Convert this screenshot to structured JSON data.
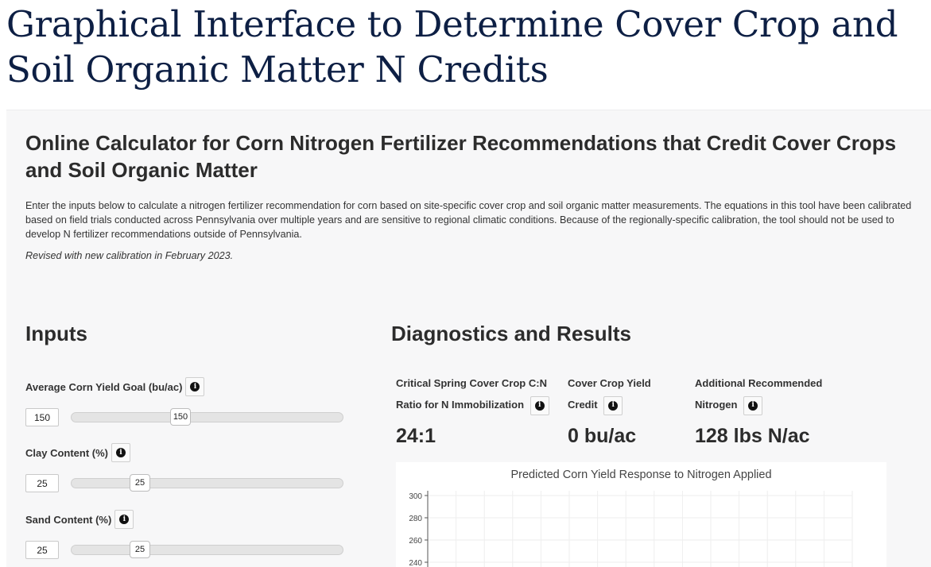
{
  "page": {
    "title": "Graphical Interface to Determine Cover Crop and Soil Organic Matter N Credits"
  },
  "calculator": {
    "title": "Online Calculator for Corn Nitrogen Fertilizer Recommendations that Credit Cover Crops and Soil Organic Matter",
    "intro": "Enter the inputs below to calculate a nitrogen fertilizer recommendation for corn based on site-specific cover crop and soil organic matter measurements. The equations in this tool have been calibrated based on field trials conducted across Pennsylvania over multiple years and are sensitive to regional climatic conditions. Because of the regionally-specific calibration, the tool should not be used to develop N fertilizer recommendations outside of Pennsylvania.",
    "revised": "Revised with new calibration in February 2023."
  },
  "inputs": {
    "heading": "Inputs",
    "fields": [
      {
        "label": "Average Corn Yield Goal (bu/ac)",
        "value": "150",
        "slider_position": 0.42,
        "icon": "info-icon"
      },
      {
        "label": "Clay Content (%)",
        "value": "25",
        "slider_position": 0.25,
        "icon": "info-icon"
      },
      {
        "label": "Sand Content (%)",
        "value": "25",
        "slider_position": 0.25,
        "icon": "info-icon"
      }
    ]
  },
  "results": {
    "heading": "Diagnostics and Results",
    "metrics": [
      {
        "label_line1": "Critical Spring Cover Crop C:N",
        "label_line2": "Ratio for N Immobilization",
        "value": "24:1",
        "icon": "info-icon"
      },
      {
        "label_line1": "Cover Crop Yield",
        "label_line2": "Credit",
        "value": "0 bu/ac",
        "icon": "info-icon"
      },
      {
        "label_line1": "Additional Recommended",
        "label_line2": "Nitrogen",
        "value": "128 lbs N/ac",
        "icon": "info-icon"
      }
    ]
  },
  "chart_data": {
    "type": "line",
    "title": "Predicted Corn Yield Response to Nitrogen Applied",
    "y_ticks": [
      "300",
      "280",
      "260",
      "240"
    ],
    "ylim": [
      240,
      300
    ],
    "grid": true,
    "series": []
  },
  "colors": {
    "title": "#0d1f44",
    "panel_background": "#f7f7f8"
  }
}
